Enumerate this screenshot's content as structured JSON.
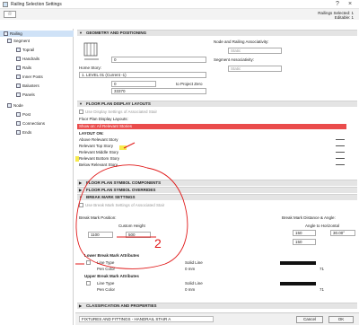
{
  "window": {
    "title": "Railing Selection Settings",
    "close": "×",
    "help": "?"
  },
  "toolbar": {
    "favorites_icon": "star-icon",
    "selected_label": "Railings Selected: 1",
    "editable_label": "Editable: 1"
  },
  "tree": [
    {
      "label": "Railing",
      "icon": "railing-icon"
    },
    {
      "label": "Segment",
      "icon": "segment-icon"
    },
    {
      "label": "Toprail",
      "icon": "toprail-icon"
    },
    {
      "label": "Handrails",
      "icon": "handrail-icon"
    },
    {
      "label": "Rails",
      "icon": "rails-icon"
    },
    {
      "label": "Inner Posts",
      "icon": "post-icon"
    },
    {
      "label": "Balusters",
      "icon": "baluster-icon"
    },
    {
      "label": "Panels",
      "icon": "panel-icon"
    },
    {
      "label": "Node",
      "icon": "node-icon"
    },
    {
      "label": "Post",
      "icon": "post-icon"
    },
    {
      "label": "Connections",
      "icon": "connection-icon"
    },
    {
      "label": "Ends",
      "icon": "end-icon"
    }
  ],
  "geometry": {
    "header": "GEOMETRY AND POSITIONING",
    "top_value": "0",
    "home_story_label": "Home Story:",
    "home_story_value": "1. LEVEL 01 (Current -1)",
    "bottom_value": "0",
    "to_project_zero": "to Project Zero",
    "project_zero_value": "33370",
    "node_assoc_label": "Node and Railing Associativity:",
    "node_assoc_value": "Static",
    "segment_assoc_label": "Segment Associativity:",
    "segment_assoc_value": "Static"
  },
  "floor_plan": {
    "header": "FLOOR PLAN DISPLAY LAYOUTS",
    "use_display_settings": "Use Display Settings of Associated Stair",
    "display_layouts_label": "Floor Plan Display Layouts:",
    "show_on": "Show on: All Relevant Stories",
    "layout_on_label": "LAYOUT ON:",
    "layouts": [
      "Above Relevant Story",
      "Relevant Top Story",
      "Relevant Middle Story",
      "Relevant Bottom Story",
      "Below Relevant Story"
    ]
  },
  "symbol_components_header": "FLOOR PLAN SYMBOL COMPONENTS",
  "symbol_overrides_header": "FLOOR PLAN SYMBOL OVERRIDES",
  "break_mark": {
    "header": "BREAK MARK SETTINGS",
    "use_settings": "Use Break Mark Settings of Associated Stair",
    "position_label": "Break Mark Position:",
    "custom_height_label": "Custom Height",
    "position_value": "1100",
    "height_value": "500",
    "distance_angle_label": "Break Mark Distance & Angle:",
    "angle_label": "Angle to Horizontal",
    "distance_value": "150",
    "angle_value": "30.00°",
    "distance2_value": "150",
    "annotation_1": "1",
    "annotation_2": "2"
  },
  "lower_break": {
    "header": "Lower Break Mark Attributes",
    "line_type_label": "Line Type",
    "line_type_value": "Solid Line",
    "pen_color_label": "Pen Color",
    "pen_color_value": "0 mm",
    "pen_number": "71"
  },
  "upper_break": {
    "header": "Upper Break Mark Attributes",
    "line_type_label": "Line Type",
    "line_type_value": "Solid Line",
    "pen_color_label": "Pen Color",
    "pen_color_value": "0 mm",
    "pen_number": "71"
  },
  "classification_header": "CLASSIFICATION AND PROPERTIES",
  "footer": {
    "layer_value": "FIXTURES AND FITTINGS - HANDRAIL STAIR A",
    "cancel": "Cancel",
    "ok": "OK"
  },
  "colors": {
    "selected_row": "#ea4c4c",
    "annotation": "#e01818",
    "highlight": "#f5e51e"
  }
}
